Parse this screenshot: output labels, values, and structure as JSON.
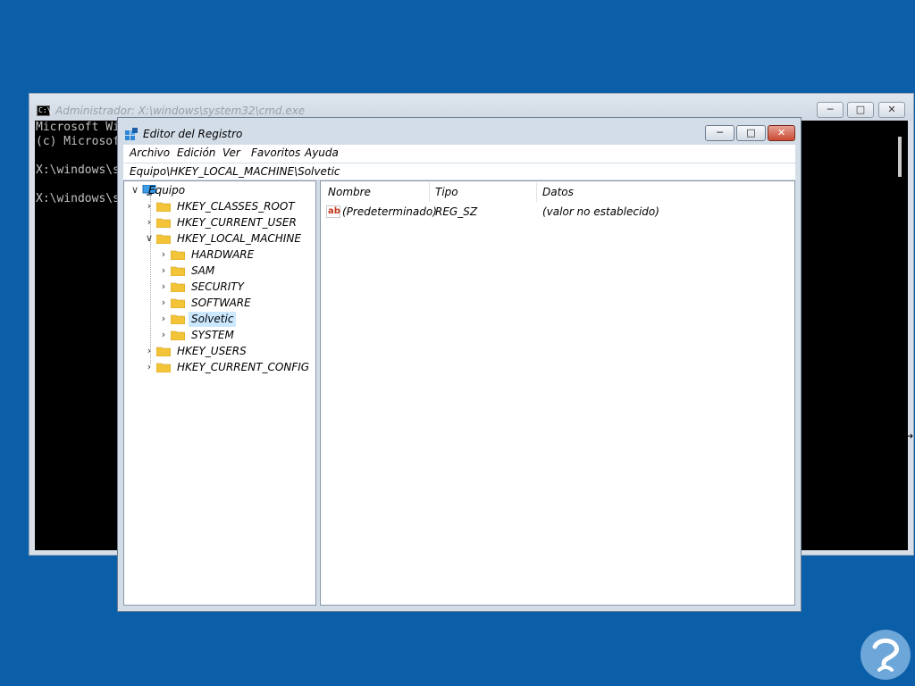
{
  "cmd": {
    "title": "Administrador: X:\\windows\\system32\\cmd.exe",
    "icon": "cmd-icon",
    "lines": [
      "Microsoft Wi",
      "(c) Microsof",
      "",
      "X:\\windows\\s",
      "",
      "X:\\windows\\s"
    ]
  },
  "regedit": {
    "title": "Editor del Registro",
    "menu": [
      "Archivo",
      "Edición",
      "Ver",
      "Favoritos",
      "Ayuda"
    ],
    "address": "Equipo\\HKEY_LOCAL_MACHINE\\Solvetic",
    "tree": {
      "root": "Equipo",
      "nodes": [
        "HKEY_CLASSES_ROOT",
        "HKEY_CURRENT_USER",
        "HKEY_LOCAL_MACHINE",
        "HARDWARE",
        "SAM",
        "SECURITY",
        "SOFTWARE",
        "Solvetic",
        "SYSTEM",
        "HKEY_USERS",
        "HKEY_CURRENT_CONFIG"
      ],
      "selected": "Solvetic"
    },
    "columns": [
      "Nombre",
      "Tipo",
      "Datos"
    ],
    "values": [
      {
        "name": "(Predeterminado)",
        "type": "REG_SZ",
        "data": "(valor no establecido)",
        "icon": "string-value-icon"
      }
    ]
  },
  "colors": {
    "desktop": "#0b5ea8",
    "selection": "#cce8ff",
    "close_button": "#c94a34",
    "logo": "#7fb3e0"
  }
}
